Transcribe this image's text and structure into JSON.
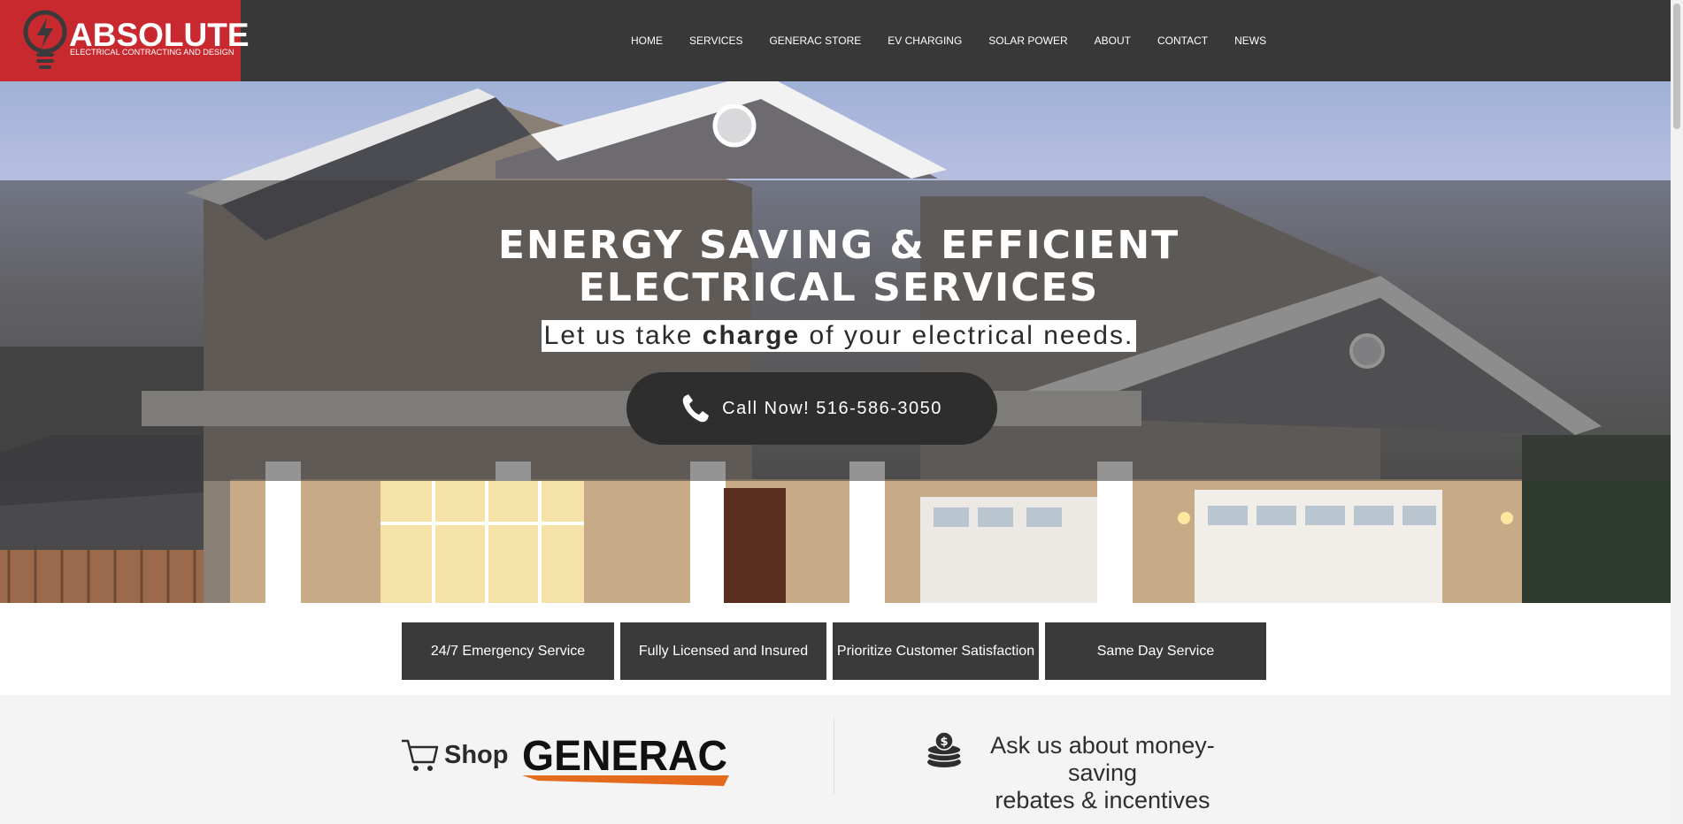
{
  "brand": {
    "name": "ABSOLUTE",
    "tagline": "ELECTRICAL CONTRACTING AND DESIGN",
    "color": "#c8292f"
  },
  "nav": {
    "items": [
      {
        "label": "HOME"
      },
      {
        "label": "SERVICES"
      },
      {
        "label": "GENERAC STORE"
      },
      {
        "label": "EV CHARGING"
      },
      {
        "label": "SOLAR POWER"
      },
      {
        "label": "ABOUT"
      },
      {
        "label": "CONTACT"
      },
      {
        "label": "NEWS"
      }
    ]
  },
  "hero": {
    "title_line1": "ENERGY SAVING & EFFICIENT",
    "title_line2": "ELECTRICAL SERVICES",
    "subtitle_before": "Let us take ",
    "subtitle_bold": "charge",
    "subtitle_after": " of your electrical needs.",
    "call_button": "Call Now! 516-586-3050",
    "call_icon": "phone-icon"
  },
  "features": [
    {
      "label": "24/7 Emergency Service"
    },
    {
      "label": "Fully Licensed and Insured"
    },
    {
      "label": "Prioritize Customer Satisfaction"
    },
    {
      "label": "Same Day Service"
    }
  ],
  "promo": {
    "shop_label": "Shop",
    "shop_icon": "cart-icon",
    "generac_logo_text": "GENERAC",
    "rebate_line1": "Ask us about money-saving",
    "rebate_line2": "rebates & incentives",
    "rebate_icon": "coins-icon",
    "generac_accent": "#e46a1e"
  }
}
